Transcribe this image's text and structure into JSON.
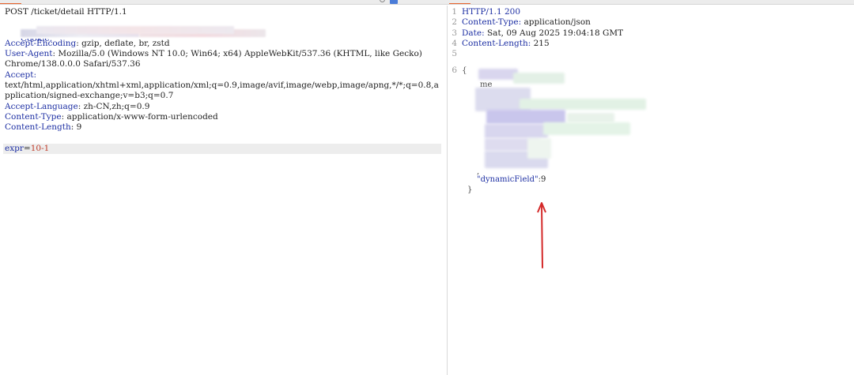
{
  "request": {
    "method_line": "POST /ticket/detail HTTP/1.1",
    "partial_header": "Cookie:",
    "headers": [
      {
        "key": "Accept-Encoding",
        "value": " gzip, deflate, br, zstd"
      },
      {
        "key": "User-Agent",
        "value": " Mozilla/5.0 (Windows NT 10.0; Win64; x64) AppleWebKit/537.36 (KHTML, like Gecko)"
      }
    ],
    "ua_continuation": "Chrome/138.0.0.0 Safari/537.36",
    "accept_key": "Accept:",
    "accept_value_1": "text/html,application/xhtml+xml,application/xml;q=0.9,image/avif,image/webp,image/apng,*/*;q=0.8,a",
    "accept_value_2": "pplication/signed-exchange;v=b3;q=0.7",
    "headers2": [
      {
        "key": "Accept-Language",
        "value": " zh-CN,zh;q=0.9"
      },
      {
        "key": "Content-Type",
        "value": " application/x-www-form-urlencoded"
      },
      {
        "key": "Content-Length",
        "value": " 9"
      }
    ],
    "body": {
      "name": "expr",
      "eq": "=",
      "value": "10-1"
    }
  },
  "response": {
    "lines": [
      {
        "num": "1",
        "key": "HTTP/1.1 200",
        "value": ""
      },
      {
        "num": "2",
        "key": "Content-Type:",
        "value": " application/json"
      },
      {
        "num": "3",
        "key": "Date:",
        "value": " Sat, 09 Aug 2025 19:04:18 GMT"
      },
      {
        "num": "4",
        "key": "Content-Length:",
        "value": " 215"
      },
      {
        "num": "5",
        "key": "",
        "value": ""
      },
      {
        "num": "6",
        "key": "",
        "value": "{"
      }
    ],
    "fragments": {
      "me": "me",
      "comma": ",",
      "dynamic_key": "\"dynamicField\"",
      "colon": ":",
      "dynamic_value": "9",
      "close": "}"
    }
  },
  "colors": {
    "header_key": "#1d2fa3",
    "param_value": "#c03d2a",
    "arrow": "#d42a2a",
    "active_tab": "#e8642c"
  }
}
